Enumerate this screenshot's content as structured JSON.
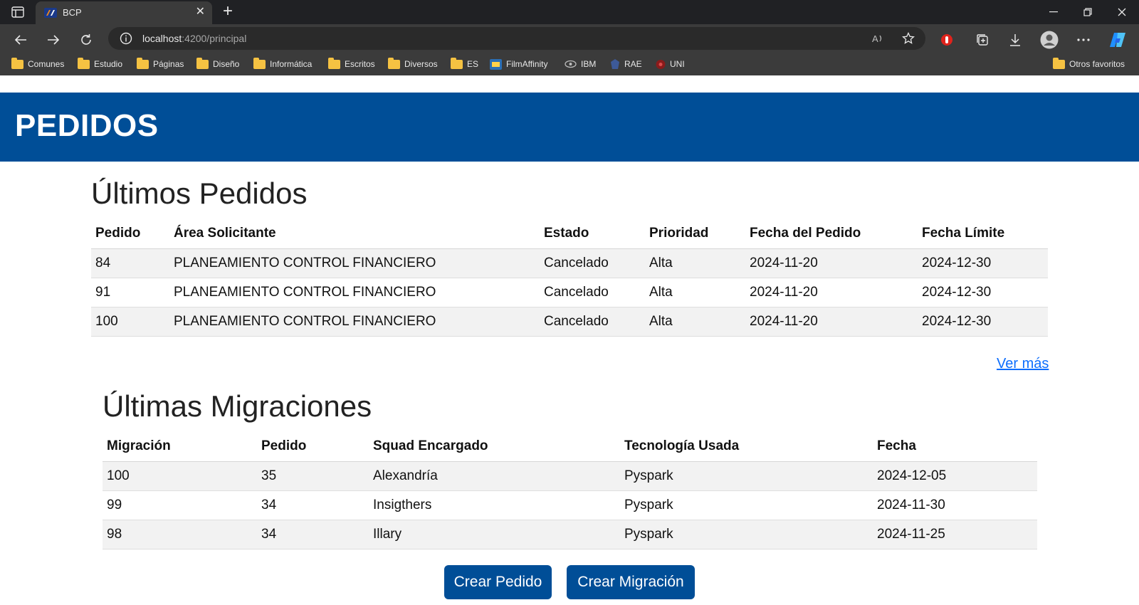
{
  "browser": {
    "tab_title": "BCP",
    "url_host": "localhost",
    "url_rest": ":4200/principal",
    "bookmarks": [
      "Comunes",
      "Estudio",
      "Páginas",
      "Diseño",
      "Informática",
      "Escritos",
      "Diversos",
      "ES",
      "FilmAffinity",
      "IBM",
      "RAE",
      "UNI"
    ],
    "other_bookmarks": "Otros favoritos"
  },
  "header": {
    "title": "PEDIDOS"
  },
  "pedidos": {
    "title": "Últimos Pedidos",
    "columns": [
      "Pedido",
      "Área Solicitante",
      "Estado",
      "Prioridad",
      "Fecha del Pedido",
      "Fecha Límite"
    ],
    "rows": [
      [
        "84",
        "PLANEAMIENTO CONTROL FINANCIERO",
        "Cancelado",
        "Alta",
        "2024-11-20",
        "2024-12-30"
      ],
      [
        "91",
        "PLANEAMIENTO CONTROL FINANCIERO",
        "Cancelado",
        "Alta",
        "2024-11-20",
        "2024-12-30"
      ],
      [
        "100",
        "PLANEAMIENTO CONTROL FINANCIERO",
        "Cancelado",
        "Alta",
        "2024-11-20",
        "2024-12-30"
      ]
    ],
    "more_link": "Ver más"
  },
  "migraciones": {
    "title": "Últimas Migraciones",
    "columns": [
      "Migración",
      "Pedido",
      "Squad Encargado",
      "Tecnología Usada",
      "Fecha"
    ],
    "rows": [
      [
        "100",
        "35",
        "Alexandría",
        "Pyspark",
        "2024-12-05"
      ],
      [
        "99",
        "34",
        "Insigthers",
        "Pyspark",
        "2024-11-30"
      ],
      [
        "98",
        "34",
        "Illary",
        "Pyspark",
        "2024-11-25"
      ]
    ]
  },
  "actions": {
    "create_order": "Crear Pedido",
    "create_migration": "Crear Migración"
  },
  "colors": {
    "primary": "#004e97",
    "link": "#0d6efd",
    "stripe": "#f2f2f2"
  }
}
